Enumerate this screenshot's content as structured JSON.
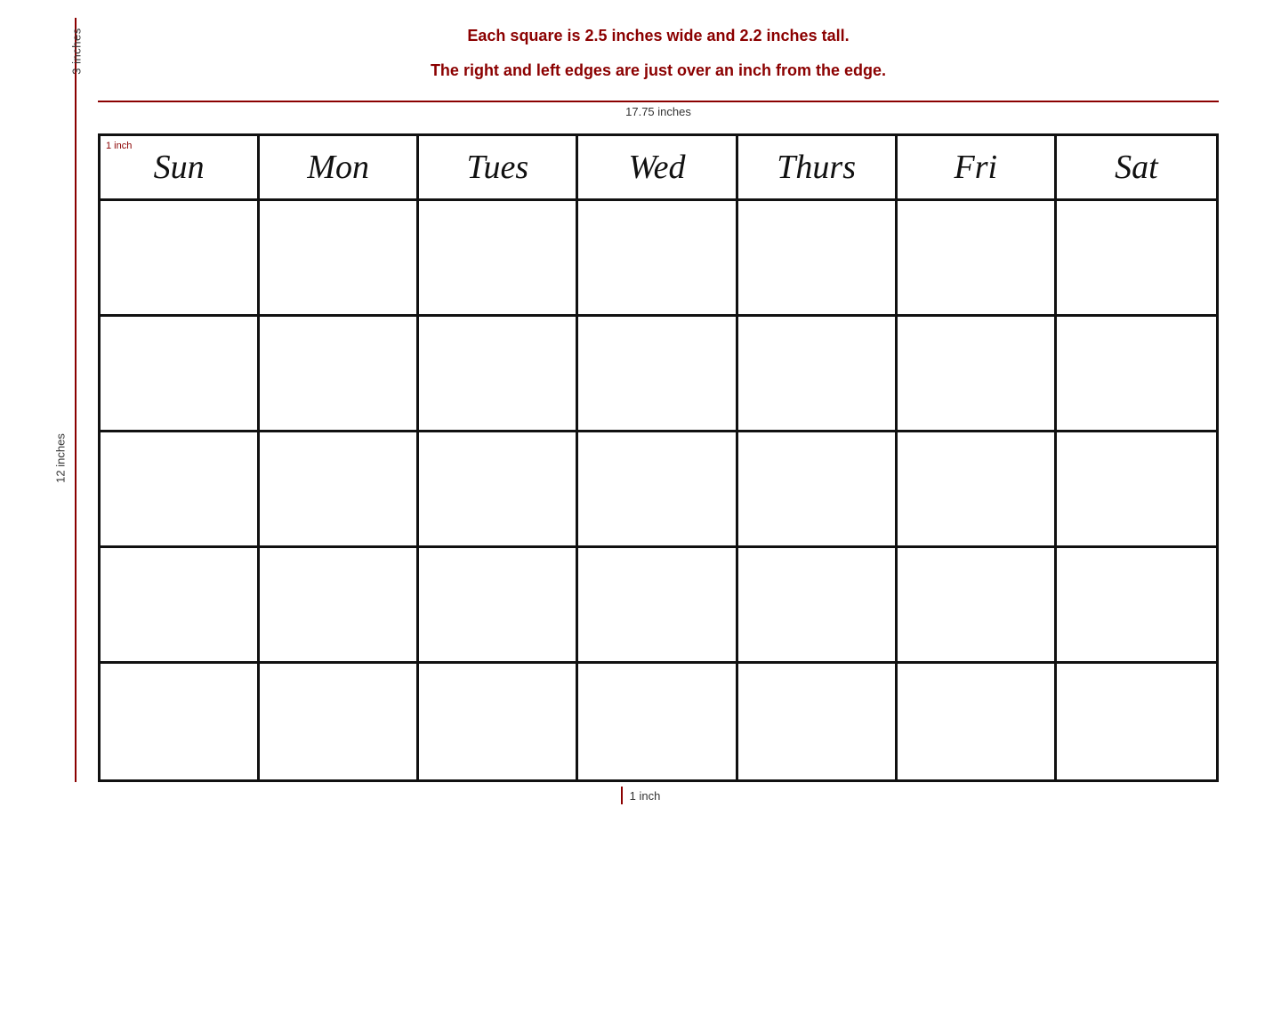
{
  "measurements": {
    "info_line1": "Each square is 2.5 inches wide and 2.2 inches tall.",
    "info_line2": "The right and left edges are just over an inch from the edge.",
    "top_vertical_label": "3 inches",
    "horizontal_label": "17.75 inches",
    "left_vertical_label": "12 inches",
    "bottom_label": "1 inch",
    "sun_inch_label": "1 inch"
  },
  "calendar": {
    "days": [
      {
        "label": "Sun",
        "id": "sun"
      },
      {
        "label": "Mon",
        "id": "mon"
      },
      {
        "label": "Tues",
        "id": "tues"
      },
      {
        "label": "Wed",
        "id": "wed"
      },
      {
        "label": "Thurs",
        "id": "thurs"
      },
      {
        "label": "Fri",
        "id": "fri"
      },
      {
        "label": "Sat",
        "id": "sat"
      }
    ],
    "rows": 5,
    "cols": 7
  }
}
